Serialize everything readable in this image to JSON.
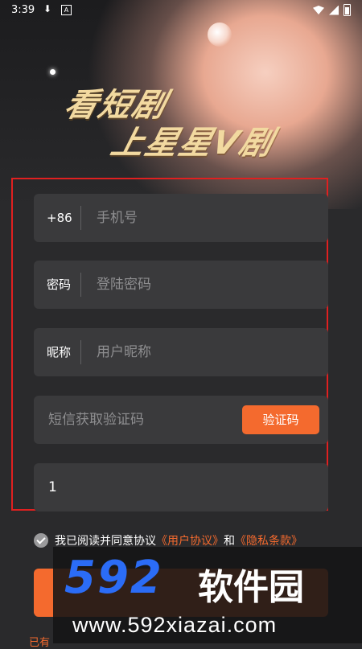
{
  "status_bar": {
    "time": "3:39",
    "download_icon": "download-icon",
    "a_icon": "A"
  },
  "hero": {
    "slogan_line1": "看短剧",
    "slogan_line2": "上星星V剧"
  },
  "form": {
    "phone": {
      "prefix": "+86",
      "placeholder": "手机号"
    },
    "password": {
      "label": "密码",
      "placeholder": "登陆密码"
    },
    "nickname": {
      "label": "昵称",
      "placeholder": "用户昵称"
    },
    "sms": {
      "placeholder": "短信获取验证码",
      "button_label": "验证码"
    },
    "invite": {
      "value": "1"
    }
  },
  "agreement": {
    "text": "我已阅读并同意协议",
    "user_agreement": "《用户协议》",
    "and": "和",
    "privacy": "《隐私条款》",
    "checked": true
  },
  "bottom_text": "已有",
  "watermark": {
    "numbers": "592",
    "chinese": "软件园",
    "url": "www.592xiazai.com"
  },
  "colors": {
    "accent": "#f46a2e",
    "background": "#2a2a2c",
    "field": "#3a3a3c",
    "frame": "#e02020",
    "watermark_blue": "#2b6cf6"
  }
}
